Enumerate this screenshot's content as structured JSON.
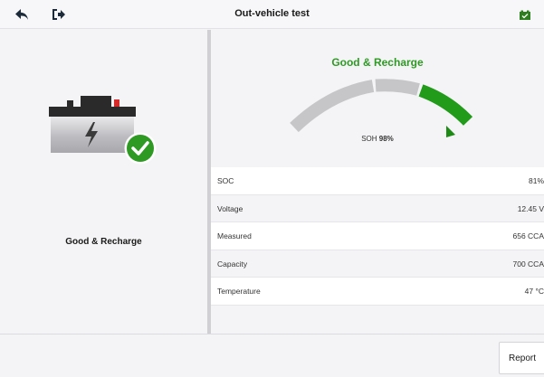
{
  "header": {
    "title": "Out-vehicle test",
    "back_icon": "back-arrow-icon",
    "exit_icon": "exit-icon",
    "battery_icon": "battery-status-icon"
  },
  "left": {
    "status": "Good & Recharge",
    "illustration_icon": "battery-check-icon"
  },
  "gauge": {
    "title": "Good & Recharge",
    "soh_label": "SOH",
    "soh_value": "98%",
    "soh_fraction": 0.98
  },
  "rows": [
    {
      "label": "SOC",
      "value": "81%"
    },
    {
      "label": "Voltage",
      "value": "12.45 V"
    },
    {
      "label": "Measured",
      "value": "656 CCA"
    },
    {
      "label": "Capacity",
      "value": "700 CCA"
    },
    {
      "label": "Temperature",
      "value": "47 °C"
    }
  ],
  "footer": {
    "report_label": "Report"
  },
  "colors": {
    "accent_green": "#2e9a24",
    "gauge_grey": "#c6c6c9"
  }
}
